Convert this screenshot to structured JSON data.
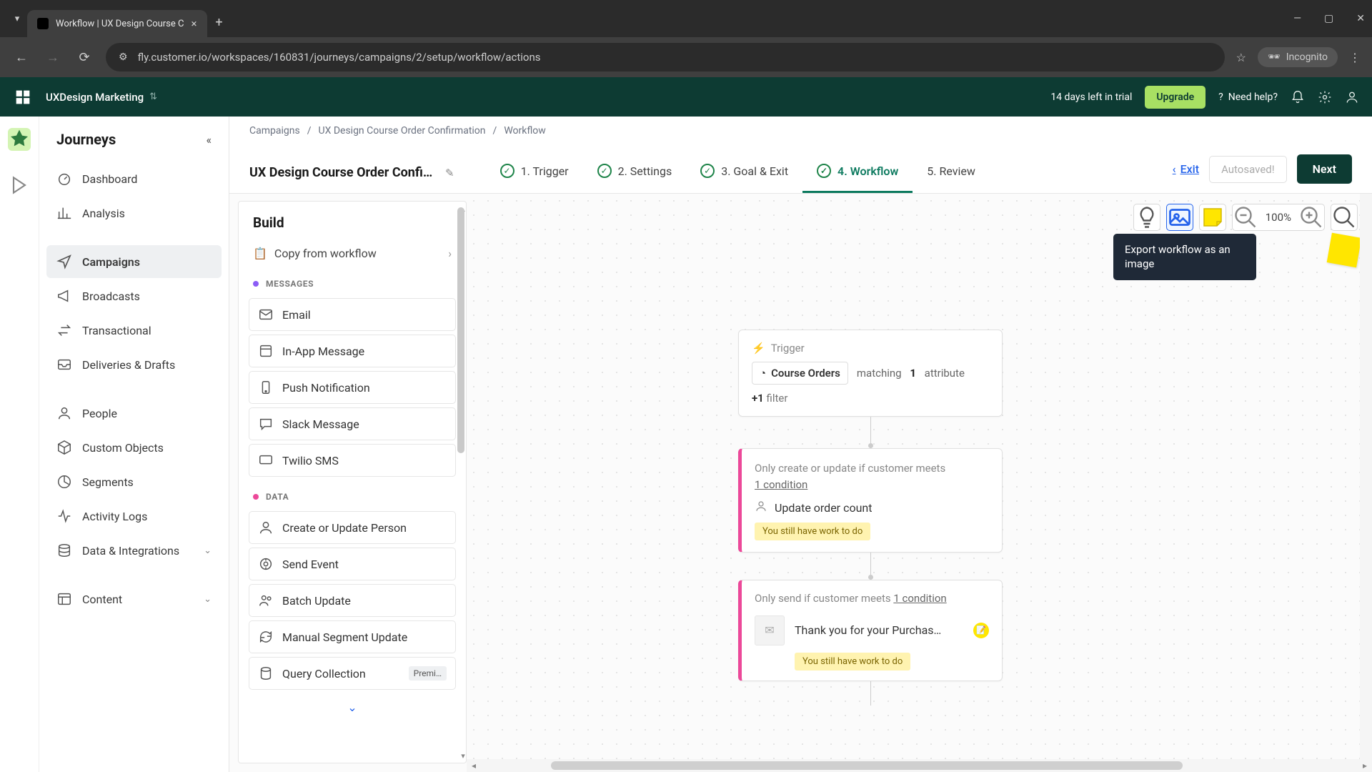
{
  "browser": {
    "tab_title": "Workflow | UX Design Course C",
    "url": "fly.customer.io/workspaces/160831/journeys/campaigns/2/setup/workflow/actions",
    "incognito": "Incognito"
  },
  "header": {
    "workspace": "UXDesign Marketing",
    "trial": "14 days left in trial",
    "upgrade": "Upgrade",
    "help": "Need help?"
  },
  "sidebar": {
    "title": "Journeys",
    "items": [
      {
        "label": "Dashboard"
      },
      {
        "label": "Analysis"
      },
      {
        "label": "Campaigns"
      },
      {
        "label": "Broadcasts"
      },
      {
        "label": "Transactional"
      },
      {
        "label": "Deliveries & Drafts"
      },
      {
        "label": "People"
      },
      {
        "label": "Custom Objects"
      },
      {
        "label": "Segments"
      },
      {
        "label": "Activity Logs"
      },
      {
        "label": "Data & Integrations"
      },
      {
        "label": "Content"
      }
    ]
  },
  "breadcrumbs": {
    "a": "Campaigns",
    "b": "UX Design Course Order Confirmation",
    "c": "Workflow"
  },
  "page": {
    "title": "UX Design Course Order Confir…",
    "steps": {
      "s1": "1. Trigger",
      "s2": "2. Settings",
      "s3": "3. Goal & Exit",
      "s4": "4. Workflow",
      "s5": "5. Review"
    },
    "exit": "Exit",
    "autosaved": "Autosaved!",
    "next": "Next"
  },
  "build": {
    "title": "Build",
    "copy": "Copy from workflow",
    "section_messages": "MESSAGES",
    "section_data": "DATA",
    "messages": {
      "email": "Email",
      "inapp": "In-App Message",
      "push": "Push Notification",
      "slack": "Slack Message",
      "twilio": "Twilio SMS"
    },
    "data_blocks": {
      "create_person": "Create or Update Person",
      "send_event": "Send Event",
      "batch": "Batch Update",
      "segment": "Manual Segment Update",
      "query": "Query Collection",
      "premium": "Premi…"
    }
  },
  "toolbar": {
    "zoom": "100%",
    "tooltip": "Export workflow as an image"
  },
  "flow": {
    "trigger": {
      "label": "Trigger",
      "segment": "Course Orders",
      "matching": "matching",
      "count": "1",
      "attr": "attribute",
      "plus1": "+1",
      "filter": "filter"
    },
    "node2": {
      "cond": "Only create or update if customer meets ",
      "cond_link": "1 condition",
      "action": "Update order count",
      "status": "You still have work to do"
    },
    "node3": {
      "cond_prefix": "Only send if customer meets ",
      "cond_link": "1 condition",
      "title": "Thank you for your Purchas…",
      "status": "You still have work to do"
    }
  }
}
